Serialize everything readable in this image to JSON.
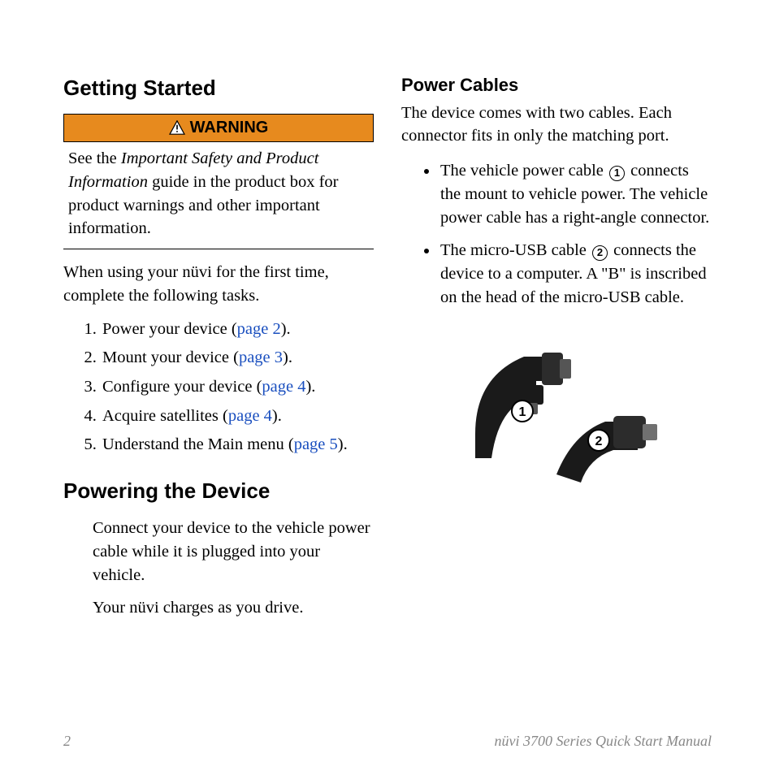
{
  "left": {
    "heading1": "Getting Started",
    "warning_label": "WARNING",
    "warning_text_prefix": "See the ",
    "warning_text_italic": "Important Safety and Product Information",
    "warning_text_suffix": " guide in the product box for product warnings and other important information.",
    "intro": "When using your nüvi for the first time, complete the following tasks.",
    "tasks": [
      {
        "text": "Power your device (",
        "link": "page 2",
        "suffix": ")."
      },
      {
        "text": "Mount your device (",
        "link": "page 3",
        "suffix": ")."
      },
      {
        "text": "Configure your device (",
        "link": "page 4",
        "suffix": ")."
      },
      {
        "text": "Acquire satellites (",
        "link": "page 4",
        "suffix": ")."
      },
      {
        "text": "Understand the Main menu (",
        "link": "page 5",
        "suffix": ")."
      }
    ],
    "heading2": "Powering the Device",
    "powering_p1": "Connect your device to the vehicle power cable while it is plugged into your vehicle.",
    "powering_p2": "Your nüvi charges as you drive."
  },
  "right": {
    "heading": "Power Cables",
    "intro": "The device comes with two cables. Each connector fits in only the matching port.",
    "bullets": [
      {
        "before": "The vehicle power cable ",
        "num": "1",
        "after": " connects the mount to vehicle power. The vehicle power cable has a right-angle connector."
      },
      {
        "before": "The micro-USB cable ",
        "num": "2",
        "after": " connects the device to a computer. A \"B\" is inscribed on the head of the micro-USB cable."
      }
    ],
    "callout1": "1",
    "callout2": "2"
  },
  "footer": {
    "page": "2",
    "title": "nüvi 3700 Series Quick Start Manual"
  }
}
